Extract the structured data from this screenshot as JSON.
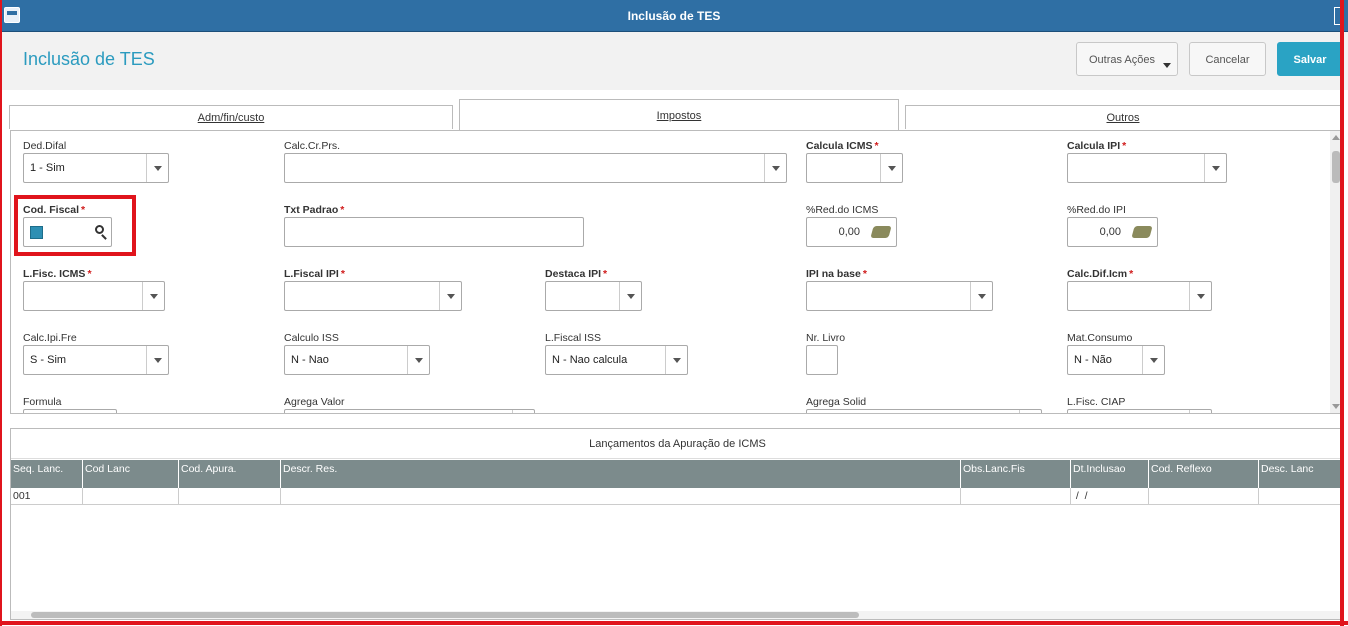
{
  "window": {
    "title": "Inclusão de TES"
  },
  "header": {
    "title": "Inclusão de TES",
    "more_actions": "Outras Ações",
    "cancel": "Cancelar",
    "save": "Salvar"
  },
  "tabs": [
    "Adm/fin/custo",
    "Impostos",
    "Outros"
  ],
  "fields": {
    "ded_difal": {
      "label": "Ded.Difal",
      "value": "1 - Sim"
    },
    "calc_cr_prs": {
      "label": "Calc.Cr.Prs.",
      "value": ""
    },
    "calcula_icms": {
      "label": "Calcula ICMS",
      "value": ""
    },
    "calcula_ipi": {
      "label": "Calcula IPI",
      "value": ""
    },
    "cod_fiscal": {
      "label": "Cod. Fiscal",
      "value": ""
    },
    "txt_padrao": {
      "label": "Txt Padrao",
      "value": ""
    },
    "red_icms": {
      "label": "%Red.do ICMS",
      "value": "0,00"
    },
    "red_ipi": {
      "label": "%Red.do IPI",
      "value": "0,00"
    },
    "lfisc_icms": {
      "label": "L.Fisc. ICMS",
      "value": ""
    },
    "lfiscal_ipi": {
      "label": "L.Fiscal IPI",
      "value": ""
    },
    "destaca_ipi": {
      "label": "Destaca IPI",
      "value": ""
    },
    "ipi_na_base": {
      "label": "IPI na base",
      "value": ""
    },
    "calc_dif_icm": {
      "label": "Calc.Dif.Icm",
      "value": ""
    },
    "calc_ipi_fre": {
      "label": "Calc.Ipi.Fre",
      "value": "S - Sim"
    },
    "calculo_iss": {
      "label": "Calculo ISS",
      "value": "N - Nao"
    },
    "lfiscal_iss": {
      "label": "L.Fiscal ISS",
      "value": "N - Nao calcula"
    },
    "nr_livro": {
      "label": "Nr. Livro",
      "value": ""
    },
    "mat_consumo": {
      "label": "Mat.Consumo",
      "value": "N - Não"
    },
    "formula": {
      "label": "Formula"
    },
    "agrega_valor": {
      "label": "Agrega Valor"
    },
    "agrega_solid": {
      "label": "Agrega Solid"
    },
    "lfisc_ciap": {
      "label": "L.Fisc. CIAP"
    }
  },
  "grid": {
    "title": "Lançamentos da Apuração de ICMS",
    "columns": [
      "Seq. Lanc.",
      "Cod Lanc",
      "Cod. Apura.",
      "Descr. Res.",
      "Obs.Lanc.Fis",
      "Dt.Inclusao",
      "Cod. Reflexo",
      "Desc. Lanc"
    ],
    "rows": [
      [
        "001",
        "",
        "",
        "",
        "",
        " /  /",
        "",
        ""
      ]
    ]
  },
  "icons": {
    "window": "window-icon",
    "search": "search-icon",
    "calculator": "calculator-icon"
  },
  "colors": {
    "titlebar": "#2f6fa4",
    "accent": "#2aa3c4",
    "required": "#d01c1c",
    "highlight": "#e0141c",
    "grid_header": "#7c8b8c"
  }
}
